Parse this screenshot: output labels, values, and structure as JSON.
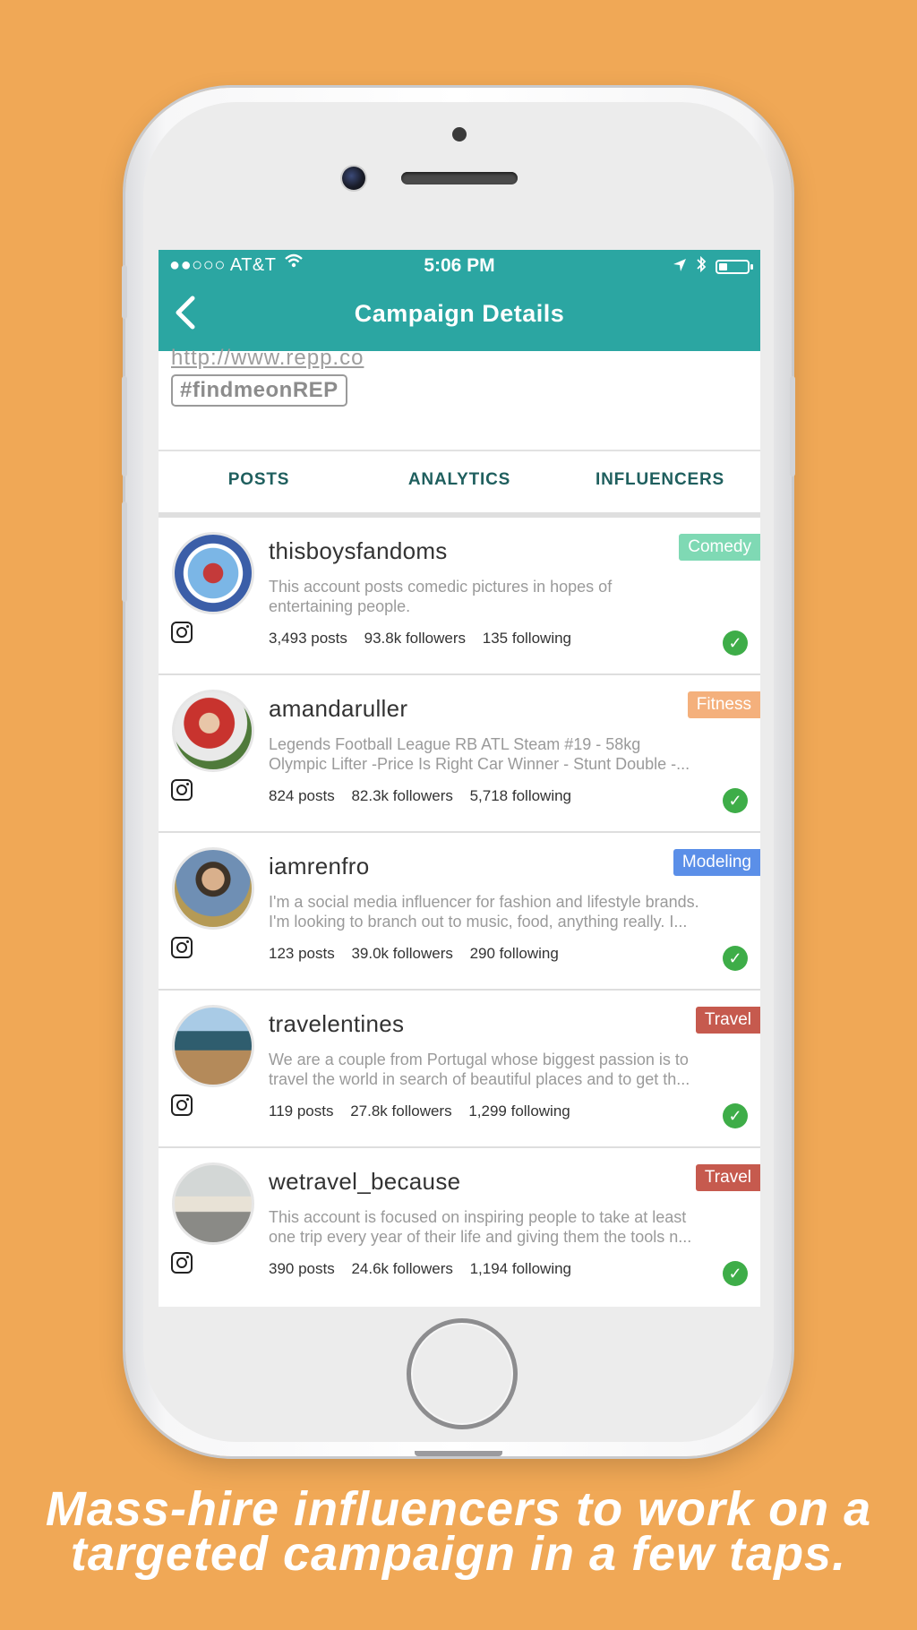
{
  "status_bar": {
    "carrier": "●●○○○ AT&T",
    "time": "5:06 PM",
    "battery_level": 0.3
  },
  "header": {
    "title": "Campaign Details",
    "back_icon": "chevron-left-icon"
  },
  "campaign": {
    "link_partial": "http://www.repp.co",
    "hashtag": "#findmeonREP"
  },
  "tabs": [
    {
      "label": "POSTS",
      "active": false
    },
    {
      "label": "ANALYTICS",
      "active": false
    },
    {
      "label": "INFLUENCERS",
      "active": true
    }
  ],
  "influencers": [
    {
      "handle": "thisboysfandoms",
      "category": "Comedy",
      "category_color": "#7FD9B4",
      "bio": [
        "This account posts comedic pictures in hopes of",
        "entertaining people."
      ],
      "posts": "3,493 posts",
      "followers": "93.8k followers",
      "following": "135 following",
      "platform_icon": "instagram-icon",
      "selected": true
    },
    {
      "handle": "amandaruller",
      "category": "Fitness",
      "category_color": "#F4B07C",
      "bio": [
        "Legends Football League RB ATL Steam #19 - 58kg",
        "Olympic Lifter -Price Is Right Car Winner - Stunt Double -..."
      ],
      "posts": "824 posts",
      "followers": "82.3k followers",
      "following": "5,718 following",
      "platform_icon": "instagram-icon",
      "selected": true
    },
    {
      "handle": "iamrenfro",
      "category": "Modeling",
      "category_color": "#5B8FE8",
      "bio": [
        "I'm a social media influencer for fashion and lifestyle brands.",
        "I'm looking to branch out to music, food, anything really. I..."
      ],
      "posts": "123 posts",
      "followers": "39.0k followers",
      "following": "290 following",
      "platform_icon": "instagram-icon",
      "selected": true
    },
    {
      "handle": "travelentines",
      "category": "Travel",
      "category_color": "#C65A4E",
      "bio": [
        "We are a couple from Portugal whose biggest passion is to",
        "travel the world in search of beautiful places and to get th..."
      ],
      "posts": "119 posts",
      "followers": "27.8k followers",
      "following": "1,299 following",
      "platform_icon": "instagram-icon",
      "selected": true
    },
    {
      "handle": "wetravel_because",
      "category": "Travel",
      "category_color": "#C65A4E",
      "bio": [
        "This account is focused on inspiring people to take at least",
        "one trip every year of their life and giving them the tools n..."
      ],
      "posts": "390 posts",
      "followers": "24.6k followers",
      "following": "1,194 following",
      "platform_icon": "instagram-icon",
      "selected": true
    }
  ],
  "tagline": [
    "Mass-hire influencers to work on a",
    "targeted campaign in a few taps."
  ],
  "colors": {
    "background": "#F0A856",
    "brand_teal": "#2BA6A2",
    "check_green": "#3EAD48"
  }
}
